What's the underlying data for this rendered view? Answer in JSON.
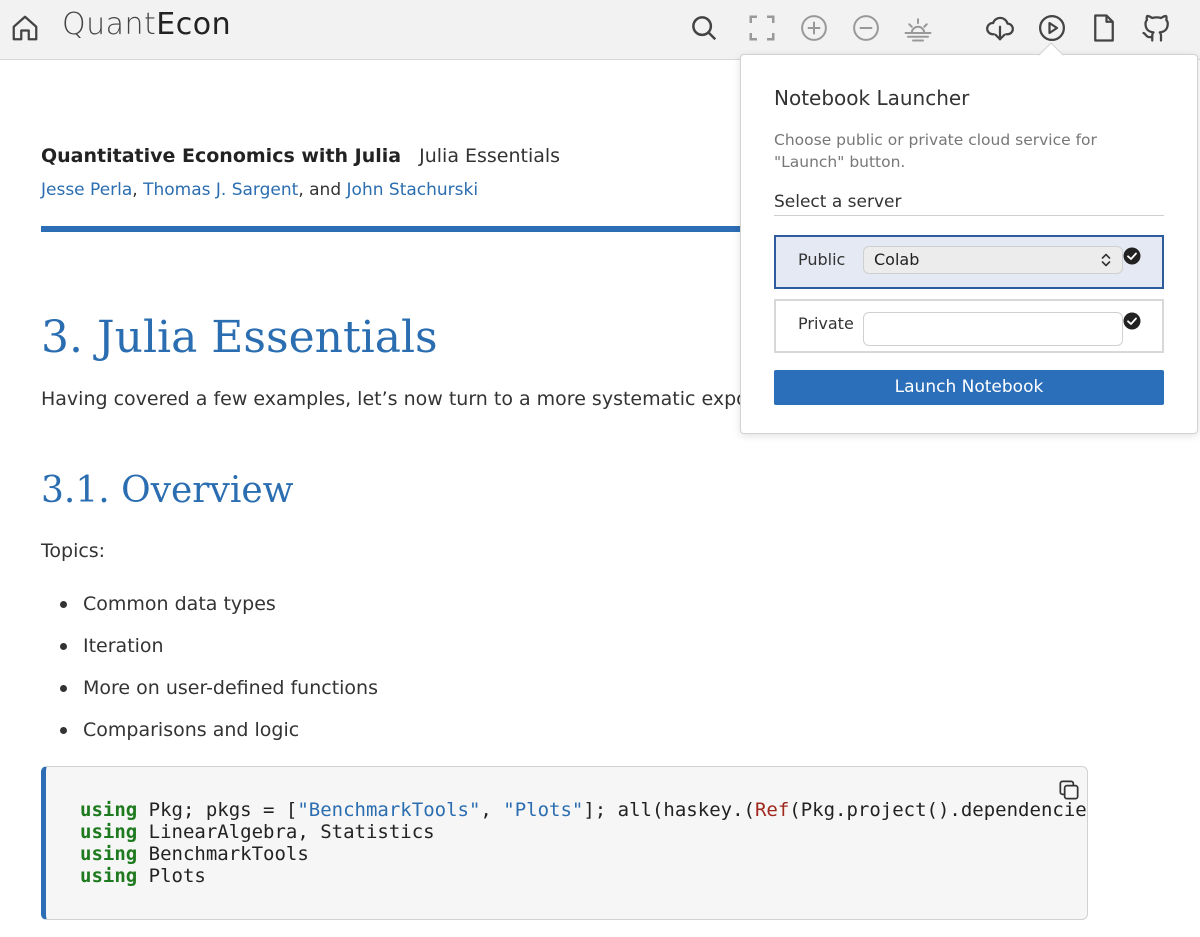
{
  "toolbar": {
    "brand_part1": "Quant",
    "brand_part2": "Econ",
    "icons": [
      "home-icon",
      "search-icon",
      "fullscreen-icon",
      "zoom-in-icon",
      "zoom-out-icon",
      "theme-toggle-icon",
      "download-icon",
      "launch-notebook-icon",
      "source-file-icon",
      "github-icon"
    ]
  },
  "header": {
    "book_title": "Quantitative Economics with Julia",
    "chapter_title": "Julia Essentials",
    "authors": [
      "Jesse Perla",
      "Thomas J. Sargent",
      "John Stachurski"
    ],
    "author_sep1": ", ",
    "author_sep2": ", and "
  },
  "main": {
    "h1": "3. Julia Essentials",
    "intro": "Having covered a few examples, let’s now turn to a more systematic exposition of",
    "h2": "3.1. Overview",
    "topics_label": "Topics:",
    "topics": [
      "Common data types",
      "Iteration",
      "More on user-defined functions",
      "Comparisons and logic"
    ]
  },
  "code": {
    "line1_kw": "using",
    "line1_a": " Pkg; pkgs = [",
    "line1_s1": "\"BenchmarkTools\"",
    "line1_b": ", ",
    "line1_s2": "\"Plots\"",
    "line1_c": "]; all(haskey.(",
    "line1_fn": "Ref",
    "line1_d": "(Pkg.project().dependencies",
    "line2_kw": "using",
    "line2_rest": " LinearAlgebra, Statistics",
    "line3_kw": "using",
    "line3_rest": " BenchmarkTools",
    "line4_kw": "using",
    "line4_rest": " Plots"
  },
  "popup": {
    "title": "Notebook Launcher",
    "description": "Choose public or private cloud service for \"Launch\" button.",
    "select_label": "Select a server",
    "public_label": "Public",
    "public_value": "Colab",
    "private_label": "Private",
    "private_value": "",
    "launch_button": "Launch Notebook"
  },
  "colors": {
    "accent": "#2b6fba",
    "heading": "#2a6db0",
    "keyword": "#1e7a1e"
  }
}
